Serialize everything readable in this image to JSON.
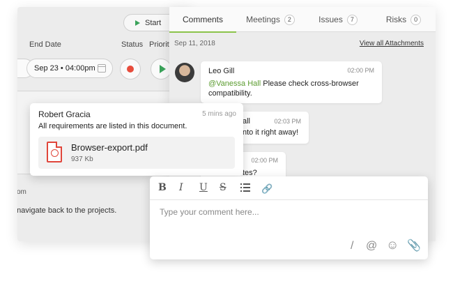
{
  "back_panel": {
    "start_label": "Start",
    "end_date_label": "End Date",
    "end_date_value": "Sep 23 • 04:00pm",
    "status_label": "Status",
    "priority_label": "Priority",
    "footer_fragment": "om",
    "footer_text": "o navigate back to the projects."
  },
  "tabs": [
    {
      "label": "Comments",
      "count": ""
    },
    {
      "label": "Meetings",
      "count": "2"
    },
    {
      "label": "Issues",
      "count": "7"
    },
    {
      "label": "Risks",
      "count": "0"
    }
  ],
  "thread": {
    "date": "Sep 11, 2018",
    "view_all": "View all Attachments",
    "leo": {
      "name": "Leo Gill",
      "time": "02:00 PM",
      "mention": "@Vanessa Hall",
      "text_1": " Please check cross-browser",
      "text_2": "compatibility."
    },
    "vanessa": {
      "name_fragment": "all",
      "time": "02:03 PM",
      "text": "nto it right away!"
    },
    "third": {
      "time": "02:00 PM",
      "text": "tes?"
    }
  },
  "robert_card": {
    "name": "Robert Gracia",
    "time": "5 mins ago",
    "message": "All requirements are listed in this document.",
    "file_name": "Browser-export.pdf",
    "file_size": "937 Kb"
  },
  "editor": {
    "bold": "B",
    "italic": "I",
    "underline": "U",
    "strike": "S",
    "link": "🔗",
    "placeholder": "Type your comment here...",
    "slash": "/",
    "at": "@",
    "emoji": "☺",
    "clip": "📎"
  },
  "colors": {
    "accent_green": "#8bc34a",
    "mention_green": "#5a9b2e",
    "pdf_red": "#e0453a",
    "status_red": "#e74c3c"
  }
}
